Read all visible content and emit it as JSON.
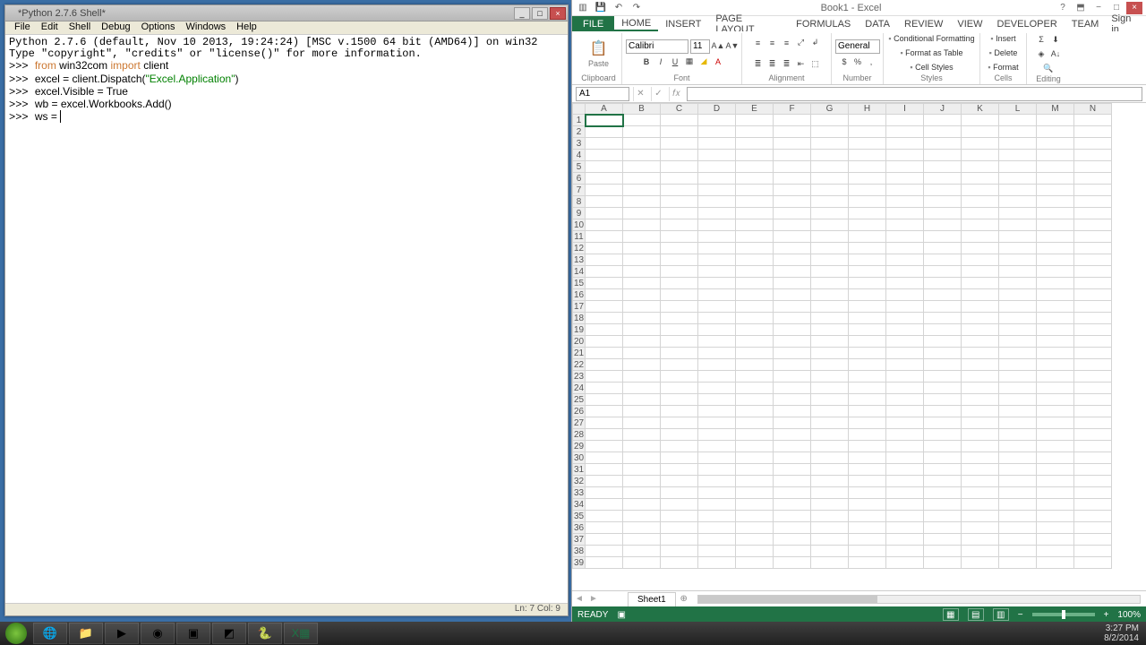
{
  "python_shell": {
    "title": "*Python 2.7.6 Shell*",
    "menu": [
      "File",
      "Edit",
      "Shell",
      "Debug",
      "Options",
      "Windows",
      "Help"
    ],
    "version_line": "Python 2.7.6 (default, Nov 10 2013, 19:24:24) [MSC v.1500 64 bit (AMD64)] on win32",
    "info_line": "Type \"copyright\", \"credits\" or \"license()\" for more information.",
    "lines": [
      {
        "prompt": ">>> ",
        "seg": [
          {
            "t": "from ",
            "c": "orange"
          },
          {
            "t": "win32com ",
            "c": "black"
          },
          {
            "t": "import ",
            "c": "orange"
          },
          {
            "t": "client",
            "c": "black"
          }
        ]
      },
      {
        "prompt": ">>> ",
        "seg": [
          {
            "t": "excel = client.Dispatch(",
            "c": "black"
          },
          {
            "t": "\"Excel.Application\"",
            "c": "green"
          },
          {
            "t": ")",
            "c": "black"
          }
        ]
      },
      {
        "prompt": ">>> ",
        "seg": [
          {
            "t": "excel.Visible = True",
            "c": "black"
          }
        ]
      },
      {
        "prompt": ">>> ",
        "seg": [
          {
            "t": "wb = excel.Workbooks.Add()",
            "c": "black"
          }
        ]
      },
      {
        "prompt": ">>> ",
        "seg": [
          {
            "t": "ws = ",
            "c": "black"
          }
        ],
        "cursor": true
      }
    ],
    "status": "Ln: 7 Col: 9"
  },
  "excel": {
    "qat": {
      "title": "Book1 - Excel",
      "sys_min": "−",
      "sys_max": "□",
      "sys_close": "×",
      "help": "?",
      "ropt": "⬒"
    },
    "tabs": [
      "HOME",
      "INSERT",
      "PAGE LAYOUT",
      "FORMULAS",
      "DATA",
      "REVIEW",
      "VIEW",
      "DEVELOPER",
      "TEAM"
    ],
    "file_tab": "FILE",
    "signin": "Sign in",
    "ribbon": {
      "clipboard": {
        "label": "Clipboard",
        "paste": "Paste"
      },
      "font": {
        "label": "Font",
        "name": "Calibri",
        "size": "11"
      },
      "alignment": {
        "label": "Alignment"
      },
      "number": {
        "label": "Number",
        "fmt": "General"
      },
      "styles": {
        "label": "Styles",
        "items": [
          "Conditional Formatting",
          "Format as Table",
          "Cell Styles"
        ]
      },
      "cells": {
        "label": "Cells",
        "items": [
          "Insert",
          "Delete",
          "Format"
        ]
      },
      "editing": {
        "label": "Editing"
      }
    },
    "formula_bar": {
      "name_box": "A1",
      "cancel": "✕",
      "enter": "✓",
      "fx": "𝑓𝑥"
    },
    "columns": [
      "A",
      "B",
      "C",
      "D",
      "E",
      "F",
      "G",
      "H",
      "I",
      "J",
      "K",
      "L",
      "M",
      "N"
    ],
    "rows": 39,
    "active_cell": "A1",
    "sheet_tabs": {
      "nav_prev": "◄",
      "nav_next": "►",
      "sheet": "Sheet1",
      "add": "⊕"
    },
    "status_bar": {
      "ready": "READY",
      "zoom": "100%",
      "minus": "−",
      "plus": "+"
    }
  },
  "taskbar": {
    "clock_time": "3:27 PM",
    "clock_date": "8/2/2014"
  }
}
